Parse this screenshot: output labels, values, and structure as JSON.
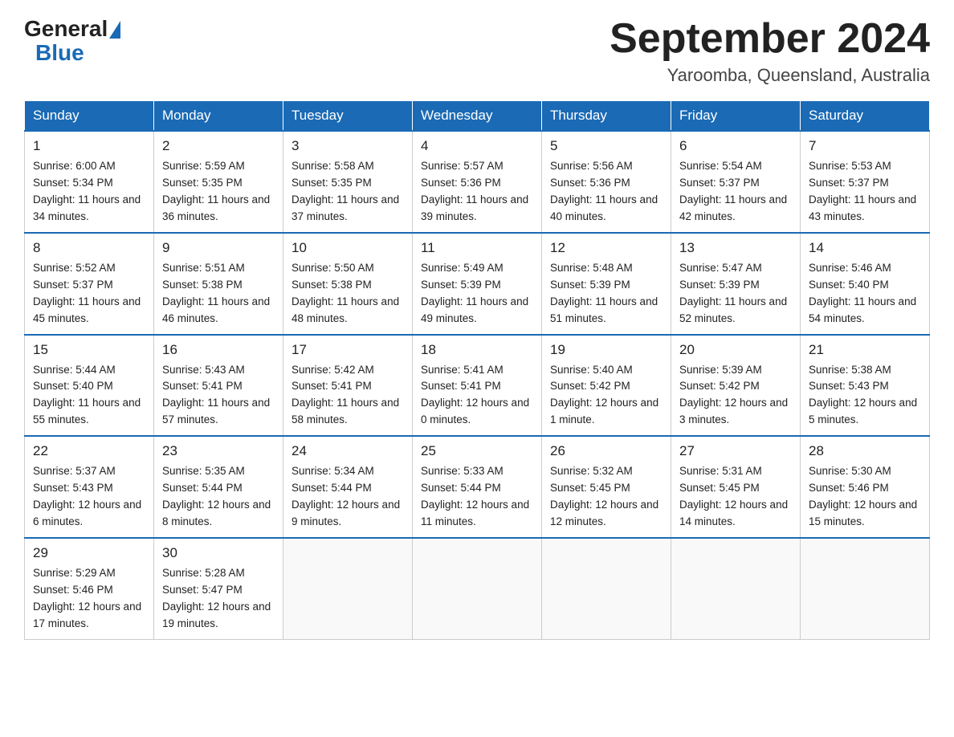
{
  "logo": {
    "text_general": "General",
    "text_blue": "Blue"
  },
  "title": {
    "month_year": "September 2024",
    "location": "Yaroomba, Queensland, Australia"
  },
  "headers": [
    "Sunday",
    "Monday",
    "Tuesday",
    "Wednesday",
    "Thursday",
    "Friday",
    "Saturday"
  ],
  "weeks": [
    [
      {
        "day": "1",
        "sunrise": "6:00 AM",
        "sunset": "5:34 PM",
        "daylight": "11 hours and 34 minutes."
      },
      {
        "day": "2",
        "sunrise": "5:59 AM",
        "sunset": "5:35 PM",
        "daylight": "11 hours and 36 minutes."
      },
      {
        "day": "3",
        "sunrise": "5:58 AM",
        "sunset": "5:35 PM",
        "daylight": "11 hours and 37 minutes."
      },
      {
        "day": "4",
        "sunrise": "5:57 AM",
        "sunset": "5:36 PM",
        "daylight": "11 hours and 39 minutes."
      },
      {
        "day": "5",
        "sunrise": "5:56 AM",
        "sunset": "5:36 PM",
        "daylight": "11 hours and 40 minutes."
      },
      {
        "day": "6",
        "sunrise": "5:54 AM",
        "sunset": "5:37 PM",
        "daylight": "11 hours and 42 minutes."
      },
      {
        "day": "7",
        "sunrise": "5:53 AM",
        "sunset": "5:37 PM",
        "daylight": "11 hours and 43 minutes."
      }
    ],
    [
      {
        "day": "8",
        "sunrise": "5:52 AM",
        "sunset": "5:37 PM",
        "daylight": "11 hours and 45 minutes."
      },
      {
        "day": "9",
        "sunrise": "5:51 AM",
        "sunset": "5:38 PM",
        "daylight": "11 hours and 46 minutes."
      },
      {
        "day": "10",
        "sunrise": "5:50 AM",
        "sunset": "5:38 PM",
        "daylight": "11 hours and 48 minutes."
      },
      {
        "day": "11",
        "sunrise": "5:49 AM",
        "sunset": "5:39 PM",
        "daylight": "11 hours and 49 minutes."
      },
      {
        "day": "12",
        "sunrise": "5:48 AM",
        "sunset": "5:39 PM",
        "daylight": "11 hours and 51 minutes."
      },
      {
        "day": "13",
        "sunrise": "5:47 AM",
        "sunset": "5:39 PM",
        "daylight": "11 hours and 52 minutes."
      },
      {
        "day": "14",
        "sunrise": "5:46 AM",
        "sunset": "5:40 PM",
        "daylight": "11 hours and 54 minutes."
      }
    ],
    [
      {
        "day": "15",
        "sunrise": "5:44 AM",
        "sunset": "5:40 PM",
        "daylight": "11 hours and 55 minutes."
      },
      {
        "day": "16",
        "sunrise": "5:43 AM",
        "sunset": "5:41 PM",
        "daylight": "11 hours and 57 minutes."
      },
      {
        "day": "17",
        "sunrise": "5:42 AM",
        "sunset": "5:41 PM",
        "daylight": "11 hours and 58 minutes."
      },
      {
        "day": "18",
        "sunrise": "5:41 AM",
        "sunset": "5:41 PM",
        "daylight": "12 hours and 0 minutes."
      },
      {
        "day": "19",
        "sunrise": "5:40 AM",
        "sunset": "5:42 PM",
        "daylight": "12 hours and 1 minute."
      },
      {
        "day": "20",
        "sunrise": "5:39 AM",
        "sunset": "5:42 PM",
        "daylight": "12 hours and 3 minutes."
      },
      {
        "day": "21",
        "sunrise": "5:38 AM",
        "sunset": "5:43 PM",
        "daylight": "12 hours and 5 minutes."
      }
    ],
    [
      {
        "day": "22",
        "sunrise": "5:37 AM",
        "sunset": "5:43 PM",
        "daylight": "12 hours and 6 minutes."
      },
      {
        "day": "23",
        "sunrise": "5:35 AM",
        "sunset": "5:44 PM",
        "daylight": "12 hours and 8 minutes."
      },
      {
        "day": "24",
        "sunrise": "5:34 AM",
        "sunset": "5:44 PM",
        "daylight": "12 hours and 9 minutes."
      },
      {
        "day": "25",
        "sunrise": "5:33 AM",
        "sunset": "5:44 PM",
        "daylight": "12 hours and 11 minutes."
      },
      {
        "day": "26",
        "sunrise": "5:32 AM",
        "sunset": "5:45 PM",
        "daylight": "12 hours and 12 minutes."
      },
      {
        "day": "27",
        "sunrise": "5:31 AM",
        "sunset": "5:45 PM",
        "daylight": "12 hours and 14 minutes."
      },
      {
        "day": "28",
        "sunrise": "5:30 AM",
        "sunset": "5:46 PM",
        "daylight": "12 hours and 15 minutes."
      }
    ],
    [
      {
        "day": "29",
        "sunrise": "5:29 AM",
        "sunset": "5:46 PM",
        "daylight": "12 hours and 17 minutes."
      },
      {
        "day": "30",
        "sunrise": "5:28 AM",
        "sunset": "5:47 PM",
        "daylight": "12 hours and 19 minutes."
      },
      null,
      null,
      null,
      null,
      null
    ]
  ]
}
